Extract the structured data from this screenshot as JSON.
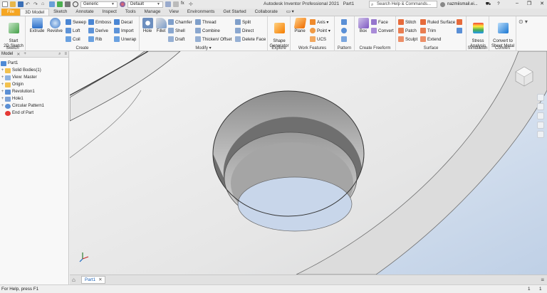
{
  "titlebar": {
    "material": "Generic",
    "appearance": "Default",
    "app_title": "Autodesk Inventor Professional 2021",
    "doc_title": "Part1",
    "search_placeholder": "Search Help & Commands...",
    "user": "nazmiismail.ei...",
    "minimize": "–",
    "restore": "❐",
    "close": "✕"
  },
  "tabs": [
    "File",
    "3D Model",
    "Sketch",
    "Annotate",
    "Inspect",
    "Tools",
    "Manage",
    "View",
    "Environments",
    "Get Started",
    "Collaborate"
  ],
  "ribbon": {
    "sketch": {
      "title": "Sketch",
      "start": "Start\n2D Sketch"
    },
    "create": {
      "title": "Create",
      "extrude": "Extrude",
      "revolve": "Revolve",
      "sweep": "Sweep",
      "loft": "Loft",
      "coil": "Coil",
      "emboss": "Emboss",
      "derive": "Derive",
      "rib": "Rib",
      "decal": "Decal",
      "import": "Import",
      "unwrap": "Unwrap"
    },
    "modify": {
      "title": "Modify ▾",
      "hole": "Hole",
      "fillet": "Fillet",
      "chamfer": "Chamfer",
      "shell": "Shell",
      "draft": "Draft",
      "thread": "Thread",
      "combine": "Combine",
      "thicken": "Thicken/ Offset",
      "split": "Split",
      "direct": "Direct",
      "delete_face": "Delete Face"
    },
    "explore": {
      "title": "Explore",
      "shape_gen": "Shape\nGenerator"
    },
    "work": {
      "title": "Work Features",
      "plane": "Plane",
      "axis": "Axis ▾",
      "point": "Point ▾",
      "ucs": "UCS"
    },
    "pattern": {
      "title": "Pattern"
    },
    "freeform": {
      "title": "Create Freeform",
      "box": "Box",
      "face": "Face",
      "convert": "Convert"
    },
    "surface": {
      "title": "Surface",
      "stitch": "Stitch",
      "patch": "Patch",
      "sculpt": "Sculpt",
      "ruled": "Ruled Surface",
      "trim": "Trim",
      "extend": "Extend"
    },
    "simulation": {
      "title": "Simulation",
      "stress": "Stress\nAnalysis"
    },
    "convert": {
      "title": "Convert",
      "sheet": "Convert to\nSheet Metal"
    }
  },
  "browser": {
    "tab": "Model",
    "items": [
      {
        "label": "Part1",
        "expander": ""
      },
      {
        "label": "Solid Bodies(1)",
        "expander": "+"
      },
      {
        "label": "View: Master",
        "expander": "+"
      },
      {
        "label": "Origin",
        "expander": "+"
      },
      {
        "label": "Revolution1",
        "expander": "+"
      },
      {
        "label": "Hole1",
        "expander": "+"
      },
      {
        "label": "Circular Pattern1",
        "expander": "+"
      },
      {
        "label": "End of Part",
        "expander": ""
      }
    ]
  },
  "doctab": {
    "label": "Part1"
  },
  "status": {
    "help": "For Help, press F1",
    "n1": "1",
    "n2": "1"
  },
  "colors": {
    "file_tab": "#f5a623",
    "accent": "#1a5fb4"
  }
}
